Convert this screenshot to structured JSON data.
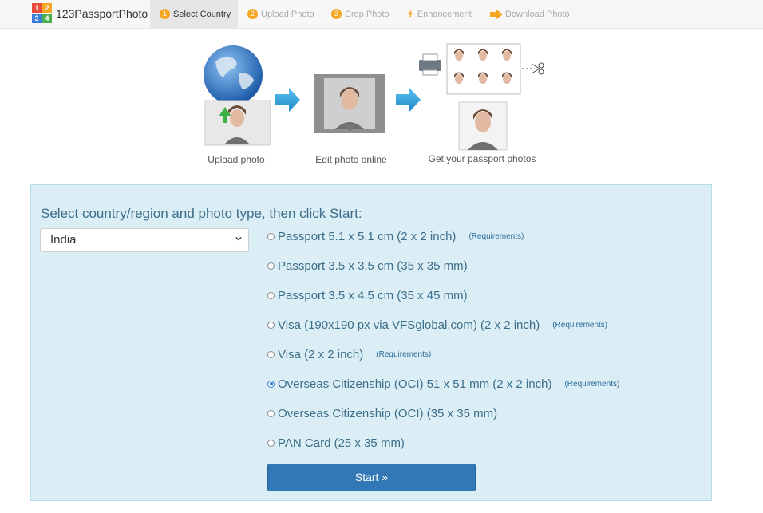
{
  "app": {
    "logo_text": "123PassportPhoto"
  },
  "nav": {
    "steps": [
      {
        "num": "1",
        "label": "Select Country"
      },
      {
        "num": "2",
        "label": "Upload Photo"
      },
      {
        "num": "3",
        "label": "Crop Photo"
      },
      {
        "num": "+",
        "label": "Enhancement"
      },
      {
        "num": "→",
        "label": "Download Photo"
      }
    ]
  },
  "hero": {
    "captions": [
      "Upload photo",
      "Edit photo online",
      "Get your passport photos"
    ]
  },
  "form": {
    "heading": "Select country/region and photo type, then click Start:",
    "country": "India",
    "options": [
      {
        "label": "Passport 5.1 x 5.1 cm (2 x 2 inch)",
        "requirements": "(Requirements)",
        "checked": false
      },
      {
        "label": "Passport 3.5 x 3.5 cm (35 x 35 mm)",
        "requirements": "",
        "checked": false
      },
      {
        "label": "Passport 3.5 x 4.5 cm (35 x 45 mm)",
        "requirements": "",
        "checked": false
      },
      {
        "label": "Visa (190x190 px via VFSglobal.com) (2 x 2 inch)",
        "requirements": "(Requirements)",
        "checked": false
      },
      {
        "label": "Visa (2 x 2 inch)",
        "requirements": "(Requirements)",
        "checked": false
      },
      {
        "label": "Overseas Citizenship (OCI) 51 x 51 mm (2 x 2 inch)",
        "requirements": "(Requirements)",
        "checked": true
      },
      {
        "label": "Overseas Citizenship (OCI) (35 x 35 mm)",
        "requirements": "",
        "checked": false
      },
      {
        "label": "PAN Card (25 x 35 mm)",
        "requirements": "",
        "checked": false
      }
    ],
    "start_label": "Start »"
  },
  "colors": {
    "accent": "#f5a623",
    "panel_bg": "#dbedf5",
    "button": "#3278b6",
    "text": "#3c6e8a"
  }
}
